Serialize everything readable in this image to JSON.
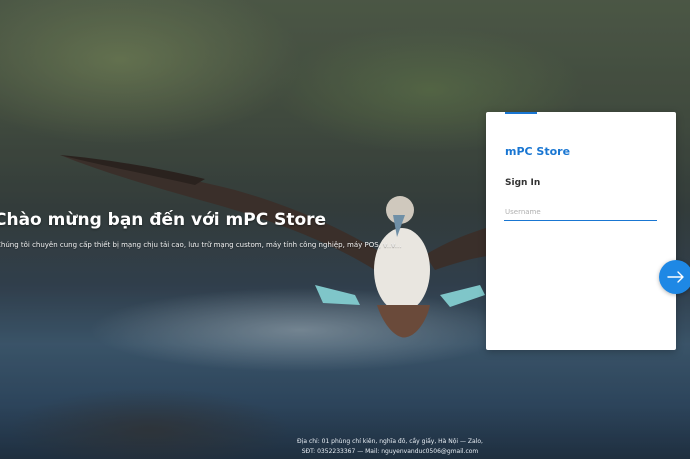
{
  "welcome": {
    "title": "Chào mừng bạn đến với mPC Store",
    "subtitle": "Chúng tôi chuyên cung cấp thiết bị mạng chịu tải cao, lưu trữ mạng custom, máy tính công nghiệp, máy POS, v..v..."
  },
  "login": {
    "brand": "mPC Store",
    "heading": "Sign In",
    "username_placeholder": "Username",
    "username_value": "",
    "next_icon": "arrow-right-icon"
  },
  "footer": {
    "address": "Địa chỉ: 01 phùng chí kiên, nghĩa đô, cầy giấy, Hà Nội — Zalo,",
    "contact": "SĐT: 0352233367 — Mail: nguyenvanduc0506@gmail.com"
  },
  "colors": {
    "accent": "#1976d2",
    "button": "#1e88e5"
  }
}
